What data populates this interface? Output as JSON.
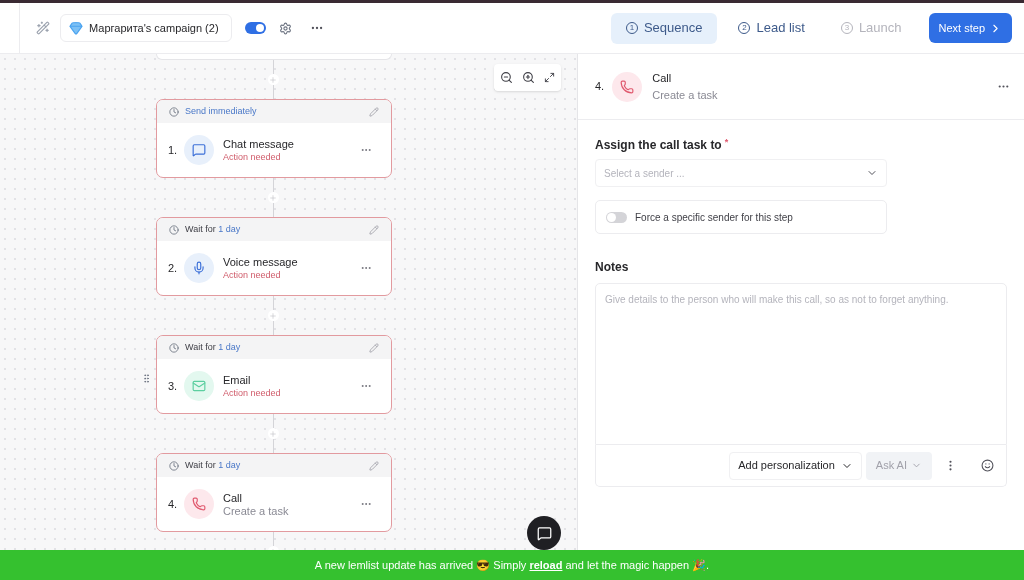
{
  "topbar": {
    "campaign": "Маргарита's campaign (2)",
    "active": true,
    "tabs": [
      {
        "number": "1",
        "label": "Sequence",
        "selected": true,
        "disabled": false
      },
      {
        "number": "2",
        "label": "Lead list",
        "selected": false,
        "disabled": false
      },
      {
        "number": "3",
        "label": "Launch",
        "selected": false,
        "disabled": true
      }
    ],
    "next": "Next step"
  },
  "steps": [
    {
      "delay": "Send immediately",
      "number": "1.",
      "kind": "chat",
      "title": "Chat message",
      "subtitle": "Action needed",
      "needs_action": true,
      "handle": false
    },
    {
      "delay": "Wait for",
      "delay_value": "1 day",
      "number": "2.",
      "kind": "voice",
      "title": "Voice message",
      "subtitle": "Action needed",
      "needs_action": true,
      "handle": false
    },
    {
      "delay": "Wait for",
      "delay_value": "1 day",
      "number": "3.",
      "kind": "email",
      "title": "Email",
      "subtitle": "Action needed",
      "needs_action": true,
      "handle": true
    },
    {
      "delay": "Wait for",
      "delay_value": "1 day",
      "number": "4.",
      "kind": "call",
      "title": "Call",
      "subtitle": "Create a task",
      "needs_action": false,
      "handle": false
    }
  ],
  "panel": {
    "number": "4.",
    "kind": "call",
    "title": "Call",
    "subtitle": "Create a task",
    "assign_label": "Assign the call task to",
    "required_mark": "*",
    "sender_placeholder": "Select a sender ...",
    "force_label": "Force a specific sender for this step",
    "force_on": false,
    "notes_label": "Notes",
    "notes_placeholder": "Give details to the person who will make this call, so as not to forget anything.",
    "personalization": "Add personalization",
    "ask_ai": "Ask AI"
  },
  "banner": {
    "before": "A new lemlist update has arrived 😎 Simply",
    "link": "reload",
    "after": "and let the magic happen 🎉."
  }
}
